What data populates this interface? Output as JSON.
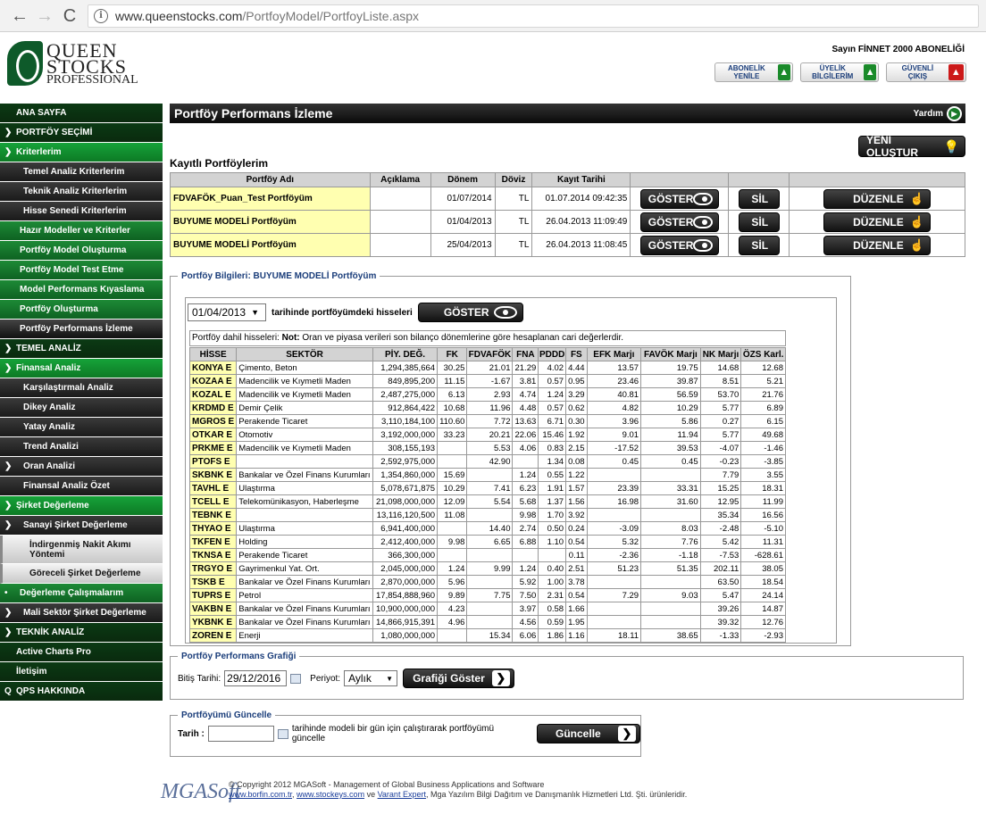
{
  "browser": {
    "url_host": "www.queenstocks.com",
    "url_path": "/PortfoyModel/PortfoyListe.aspx",
    "back_icon": "←",
    "fwd_icon": "→",
    "reload_icon": "C"
  },
  "logo": {
    "line1": "QUEEN",
    "line2": "STOCKS",
    "line3": "PROFESSIONAL"
  },
  "welcome": "Sayın FİNNET 2000 ABONELİĞİ",
  "top_buttons": [
    {
      "label": "ABONELİK YENİLE",
      "color": "#1a8a2a"
    },
    {
      "label": "ÜYELİK BİLGİLERİM",
      "color": "#1a8a2a"
    },
    {
      "label": "GÜVENLİ ÇIKIŞ",
      "color": "#cc1a1a"
    }
  ],
  "sidebar": [
    {
      "label": "ANA SAYFA",
      "cls": "l0",
      "chev": ""
    },
    {
      "label": "PORTFÖY SEÇİMİ",
      "cls": "l0",
      "chev": "❯"
    },
    {
      "label": "Kriterlerim",
      "cls": "l1",
      "chev": "❯"
    },
    {
      "label": "Temel Analiz Kriterlerim",
      "cls": "l2",
      "chev": ""
    },
    {
      "label": "Teknik Analiz Kriterlerim",
      "cls": "l2",
      "chev": ""
    },
    {
      "label": "Hisse Senedi Kriterlerim",
      "cls": "l2",
      "chev": ""
    },
    {
      "label": "Hazır Modeller ve Kriterler",
      "cls": "l2g",
      "chev": ""
    },
    {
      "label": "Portföy Model Oluşturma",
      "cls": "l2g",
      "chev": ""
    },
    {
      "label": "Portföy Model Test Etme",
      "cls": "l2g",
      "chev": ""
    },
    {
      "label": "Model Performans Kıyaslama",
      "cls": "l2g",
      "chev": ""
    },
    {
      "label": "Portföy Oluşturma",
      "cls": "l2g",
      "chev": ""
    },
    {
      "label": "Portföy Performans İzleme",
      "cls": "l2g active",
      "chev": ""
    },
    {
      "label": "TEMEL ANALİZ",
      "cls": "l0",
      "chev": "❯"
    },
    {
      "label": "Finansal Analiz",
      "cls": "l1",
      "chev": "❯"
    },
    {
      "label": "Karşılaştırmalı Analiz",
      "cls": "l2",
      "chev": ""
    },
    {
      "label": "Dikey Analiz",
      "cls": "l2",
      "chev": ""
    },
    {
      "label": "Yatay Analiz",
      "cls": "l2",
      "chev": ""
    },
    {
      "label": "Trend Analizi",
      "cls": "l2",
      "chev": ""
    },
    {
      "label": "Oran Analizi",
      "cls": "l2",
      "chev": "❯"
    },
    {
      "label": "Finansal Analiz Özet",
      "cls": "l2",
      "chev": ""
    },
    {
      "label": "Şirket Değerleme",
      "cls": "l1",
      "chev": "❯"
    },
    {
      "label": "Sanayi Şirket Değerleme",
      "cls": "l2",
      "chev": "❯"
    },
    {
      "label": "İndirgenmiş Nakit Akımı Yöntemi",
      "cls": "l3 tall",
      "chev": ""
    },
    {
      "label": "Göreceli Şirket Değerleme",
      "cls": "l3",
      "chev": ""
    },
    {
      "label": "Değerleme Çalışmalarım",
      "cls": "l2g",
      "chev": "•"
    },
    {
      "label": "Mali Sektör Şirket Değerleme",
      "cls": "l2",
      "chev": "❯"
    },
    {
      "label": "TEKNİK ANALİZ",
      "cls": "l0",
      "chev": "❯"
    },
    {
      "label": "Active Charts Pro",
      "cls": "l0",
      "chev": ""
    },
    {
      "label": "İletişim",
      "cls": "l0",
      "chev": ""
    },
    {
      "label": "QPS HAKKINDA",
      "cls": "l0",
      "chev": "Q"
    }
  ],
  "page": {
    "title": "Portföy Performans İzleme",
    "help": "Yardım",
    "new_button": "YENİ OLUŞTUR",
    "saved_title": "Kayıtlı Portföylerim"
  },
  "saved_headers": [
    "Portföy Adı",
    "Açıklama",
    "Dönem",
    "Döviz",
    "Kayıt Tarihi",
    "",
    "",
    ""
  ],
  "saved_rows": [
    {
      "name": "FDVAFÖK_Puan_Test Portföyüm",
      "desc": "",
      "period": "01/07/2014",
      "currency": "TL",
      "date": "01.07.2014 09:42:35"
    },
    {
      "name": "BUYUME MODELİ Portföyüm",
      "desc": "",
      "period": "01/04/2013",
      "currency": "TL",
      "date": "26.04.2013 11:09:49"
    },
    {
      "name": "BUYUME MODELİ Portföyüm",
      "desc": "",
      "period": "25/04/2013",
      "currency": "TL",
      "date": "26.04.2013 11:08:45"
    }
  ],
  "row_buttons": {
    "show": "GÖSTER",
    "delete": "SİL",
    "edit": "DÜZENLE"
  },
  "info": {
    "legend": "Portföy Bilgileri: BUYUME MODELİ Portföyüm",
    "date": "01/04/2013",
    "date_suffix": "tarihinde portföyümdeki hisseleri",
    "show": "GÖSTER",
    "note_prefix": "Portföy dahil hisseleri: ",
    "note_bold": "Not:",
    "note_text": " Oran ve piyasa verileri son bilanço dönemlerine göre hesaplanan cari değerlerdir."
  },
  "holding_headers": [
    "HİSSE",
    "SEKTÖR",
    "PİY. DEĞ.",
    "FK",
    "FDVAFÖK",
    "FNA",
    "PDDD",
    "FS",
    "EFK Marjı",
    "FAVÖK Marjı",
    "NK Marjı",
    "ÖZS Karl."
  ],
  "holdings": [
    [
      "KONYA E",
      "Çimento, Beton",
      "1,294,385,664",
      "30.25",
      "21.01",
      "21.29",
      "4.02",
      "4.44",
      "13.57",
      "19.75",
      "14.68",
      "12.68"
    ],
    [
      "KOZAA E",
      "Madencilik ve Kıymetli Maden",
      "849,895,200",
      "11.15",
      "-1.67",
      "3.81",
      "0.57",
      "0.95",
      "23.46",
      "39.87",
      "8.51",
      "5.21"
    ],
    [
      "KOZAL E",
      "Madencilik ve Kıymetli Maden",
      "2,487,275,000",
      "6.13",
      "2.93",
      "4.74",
      "1.24",
      "3.29",
      "40.81",
      "56.59",
      "53.70",
      "21.76"
    ],
    [
      "KRDMD E",
      "Demir Çelik",
      "912,864,422",
      "10.68",
      "11.96",
      "4.48",
      "0.57",
      "0.62",
      "4.82",
      "10.29",
      "5.77",
      "6.89"
    ],
    [
      "MGROS E",
      "Perakende Ticaret",
      "3,110,184,100",
      "110.60",
      "7.72",
      "13.63",
      "6.71",
      "0.30",
      "3.96",
      "5.86",
      "0.27",
      "6.15"
    ],
    [
      "OTKAR E",
      "Otomotiv",
      "3,192,000,000",
      "33.23",
      "20.21",
      "22.06",
      "15.46",
      "1.92",
      "9.01",
      "11.94",
      "5.77",
      "49.68"
    ],
    [
      "PRKME E",
      "Madencilik ve Kıymetli Maden",
      "308,155,193",
      "",
      "5.53",
      "4.06",
      "0.83",
      "2.15",
      "-17.52",
      "39.53",
      "-4.07",
      "-1.46"
    ],
    [
      "PTOFS E",
      "",
      "2,592,975,000",
      "",
      "42.90",
      "",
      "1.34",
      "0.08",
      "0.45",
      "0.45",
      "-0.23",
      "-3.85"
    ],
    [
      "SKBNK E",
      "Bankalar ve Özel Finans Kurumları",
      "1,354,860,000",
      "15.69",
      "",
      "1.24",
      "0.55",
      "1.22",
      "",
      "",
      "7.79",
      "3.55"
    ],
    [
      "TAVHL E",
      "Ulaştırma",
      "5,078,671,875",
      "10.29",
      "7.41",
      "6.23",
      "1.91",
      "1.57",
      "23.39",
      "33.31",
      "15.25",
      "18.31"
    ],
    [
      "TCELL E",
      "Telekomünikasyon, Haberleşme",
      "21,098,000,000",
      "12.09",
      "5.54",
      "5.68",
      "1.37",
      "1.56",
      "16.98",
      "31.60",
      "12.95",
      "11.99"
    ],
    [
      "TEBNK E",
      "",
      "13,116,120,500",
      "11.08",
      "",
      "9.98",
      "1.70",
      "3.92",
      "",
      "",
      "35.34",
      "16.56"
    ],
    [
      "THYAO E",
      "Ulaştırma",
      "6,941,400,000",
      "",
      "14.40",
      "2.74",
      "0.50",
      "0.24",
      "-3.09",
      "8.03",
      "-2.48",
      "-5.10"
    ],
    [
      "TKFEN E",
      "Holding",
      "2,412,400,000",
      "9.98",
      "6.65",
      "6.88",
      "1.10",
      "0.54",
      "5.32",
      "7.76",
      "5.42",
      "11.31"
    ],
    [
      "TKNSA E",
      "Perakende Ticaret",
      "366,300,000",
      "",
      "",
      "",
      "",
      "0.11",
      "-2.36",
      "-1.18",
      "-7.53",
      "-628.61"
    ],
    [
      "TRGYO E",
      "Gayrimenkul Yat. Ort.",
      "2,045,000,000",
      "1.24",
      "9.99",
      "1.24",
      "0.40",
      "2.51",
      "51.23",
      "51.35",
      "202.11",
      "38.05"
    ],
    [
      "TSKB E",
      "Bankalar ve Özel Finans Kurumları",
      "2,870,000,000",
      "5.96",
      "",
      "5.92",
      "1.00",
      "3.78",
      "",
      "",
      "63.50",
      "18.54"
    ],
    [
      "TUPRS E",
      "Petrol",
      "17,854,888,960",
      "9.89",
      "7.75",
      "7.50",
      "2.31",
      "0.54",
      "7.29",
      "9.03",
      "5.47",
      "24.14"
    ],
    [
      "VAKBN E",
      "Bankalar ve Özel Finans Kurumları",
      "10,900,000,000",
      "4.23",
      "",
      "3.97",
      "0.58",
      "1.66",
      "",
      "",
      "39.26",
      "14.87"
    ],
    [
      "YKBNK E",
      "Bankalar ve Özel Finans Kurumları",
      "14,866,915,391",
      "4.96",
      "",
      "4.56",
      "0.59",
      "1.95",
      "",
      "",
      "39.32",
      "12.76"
    ],
    [
      "ZOREN E",
      "Enerji",
      "1,080,000,000",
      "",
      "15.34",
      "6.06",
      "1.86",
      "1.16",
      "18.11",
      "38.65",
      "-1.33",
      "-2.93"
    ]
  ],
  "chart_section": {
    "legend": "Portföy Performans Grafiği",
    "end_label": "Bitiş Tarihi:",
    "end_value": "29/12/2016",
    "period_label": "Periyot:",
    "period_value": "Aylık",
    "button": "Grafiği Göster"
  },
  "update_section": {
    "legend": "Portföyümü Güncelle",
    "date_label": "Tarih :",
    "date_value": "",
    "hint": "tarihinde modeli bir gün için çalıştırarak portföyümü güncelle",
    "button": "Güncelle"
  },
  "footer": {
    "brand": "MGASoft",
    "line1": "© Copyright 2012 MGASoft - Management of Global Business Applications and Software",
    "link1": "www.borfin.com.tr",
    "sep1": ", ",
    "link2": "www.stockeys.com",
    "sep2": " ve ",
    "link3": "Varant Expert",
    "rest": ", Mga Yazılım Bilgi Dağıtım ve Danışmanlık Hizmetleri Ltd. Şti. ürünleridir."
  }
}
